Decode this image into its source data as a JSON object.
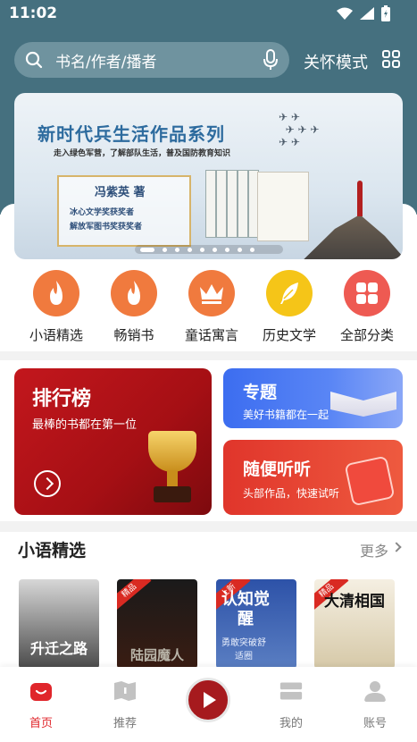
{
  "status_bar": {
    "time": "11:02"
  },
  "search": {
    "placeholder": "书名/作者/播者",
    "care_mode": "关怀模式"
  },
  "banner": {
    "title": "新时代兵生活作品系列",
    "subtitle": "走入绿色军营，了解部队生活，普及国防教育知识",
    "author": "冯紫英  著",
    "award_1": "冰心文学奖获奖者",
    "award_2": "解放军图书奖获奖者",
    "slide_count": 9,
    "active_slide": 1
  },
  "categories": [
    {
      "label": "小语精选",
      "icon": "flame-icon",
      "color": "#f07a3e"
    },
    {
      "label": "畅销书",
      "icon": "flame-icon",
      "color": "#f07a3e"
    },
    {
      "label": "童话寓言",
      "icon": "crown-icon",
      "color": "#f07a3e"
    },
    {
      "label": "历史文学",
      "icon": "feather-icon",
      "color": "#f5c518"
    },
    {
      "label": "全部分类",
      "icon": "apps-icon",
      "color": "#ee5a52"
    }
  ],
  "cards": {
    "rank": {
      "title": "排行榜",
      "subtitle": "最棒的书都在第一位"
    },
    "topic": {
      "title": "专题",
      "subtitle": "美好书籍都在一起"
    },
    "listen": {
      "title": "随便听听",
      "subtitle": "头部作品，快速试听"
    }
  },
  "section": {
    "title": "小语精选",
    "more": "更多",
    "books": [
      {
        "tag": "",
        "cover_text": "升迁之路"
      },
      {
        "tag": "精品",
        "cover_text": "陆园魔人"
      },
      {
        "tag": "上新",
        "cover_text": "认知觉醒",
        "cover_sub": "勇敢突破舒适圈"
      },
      {
        "tag": "精品",
        "cover_text": "大清相国"
      }
    ]
  },
  "bottom_nav": [
    {
      "label": "首页",
      "active": true
    },
    {
      "label": "推荐",
      "active": false
    },
    {
      "label": "我的",
      "active": false
    },
    {
      "label": "账号",
      "active": false
    }
  ],
  "colors": {
    "accent": "#e0262b",
    "header_bg": "#45707f",
    "rank_red": "#c3171d",
    "topic_blue": "#3c6df0"
  }
}
